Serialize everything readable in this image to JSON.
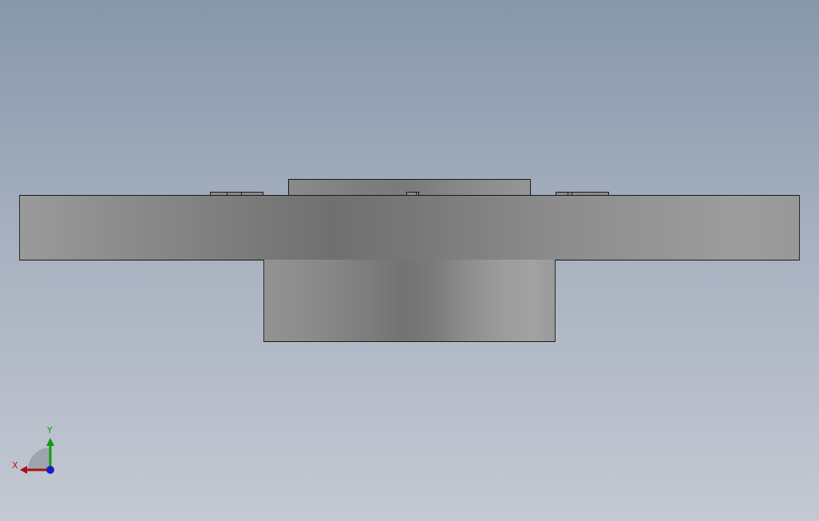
{
  "viewport": {
    "background_top": "#8797ab",
    "background_bottom": "#c4c9d3"
  },
  "model": {
    "part_color": "#808080",
    "edge_color": "#1a1a1a"
  },
  "triad": {
    "x_label": "X",
    "y_label": "Y",
    "x_color": "#cc1111",
    "y_color": "#119911",
    "z_color": "#1a1acc"
  }
}
